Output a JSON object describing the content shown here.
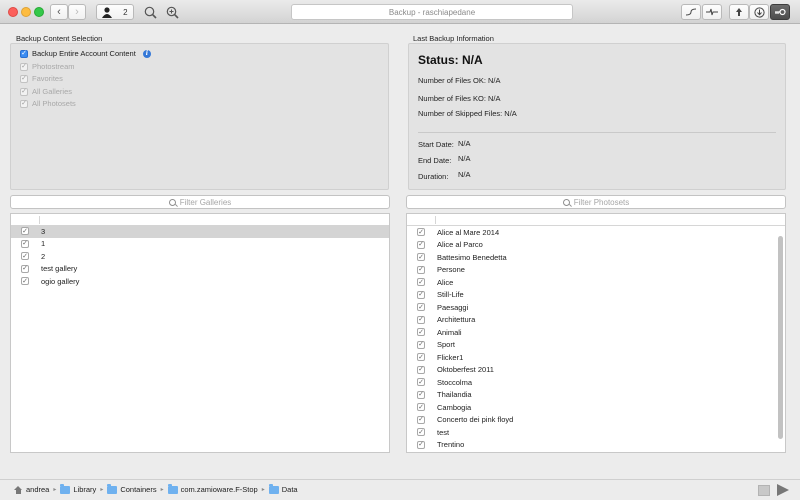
{
  "toolbar": {
    "title": "Backup - raschiapedane",
    "user_count": "2"
  },
  "backup_content": {
    "title": "Backup Content Selection",
    "options": [
      {
        "label": "Backup Entire Account Content",
        "checked": true,
        "enabled": true
      },
      {
        "label": "Photostream",
        "checked": true,
        "enabled": false
      },
      {
        "label": "Favorites",
        "checked": true,
        "enabled": false
      },
      {
        "label": "All Galleries",
        "checked": true,
        "enabled": false
      },
      {
        "label": "All Photosets",
        "checked": true,
        "enabled": false
      }
    ]
  },
  "last_backup": {
    "title": "Last Backup Information",
    "status": "Status: N/A",
    "files_ok": "Number of Files OK: N/A",
    "files_ko": "Number of Files KO: N/A",
    "skipped": "Number of Skipped Files: N/A",
    "start_label": "Start Date:",
    "start_value": "N/A",
    "end_label": "End Date:",
    "end_value": "N/A",
    "duration_label": "Duration:",
    "duration_value": "N/A"
  },
  "galleries": {
    "filter_placeholder": "Filter Galleries",
    "rows": [
      "3",
      "1",
      "2",
      "test gallery",
      "ogio gallery"
    ],
    "selected_index": 0
  },
  "photosets": {
    "filter_placeholder": "Filter Photosets",
    "rows": [
      "Alice al Mare 2014",
      "Alice al Parco",
      "Battesimo Benedetta",
      "Persone",
      "Alice",
      "Still-Life",
      "Paesaggi",
      "Architettura",
      "Animali",
      "Sport",
      "Flicker1",
      "Oktoberfest 2011",
      "Stoccolma",
      "Thailandia",
      "Cambogia",
      "Concerto dei pink floyd",
      "test",
      "Trentino"
    ]
  },
  "path": [
    "andrea",
    "Library",
    "Containers",
    "com.zamioware.F-Stop",
    "Data"
  ],
  "icons": {
    "user": "user-icon",
    "search": "magnifier-icon",
    "zoom": "zoom-icon",
    "stop": "stop-icon",
    "play": "play-icon"
  }
}
